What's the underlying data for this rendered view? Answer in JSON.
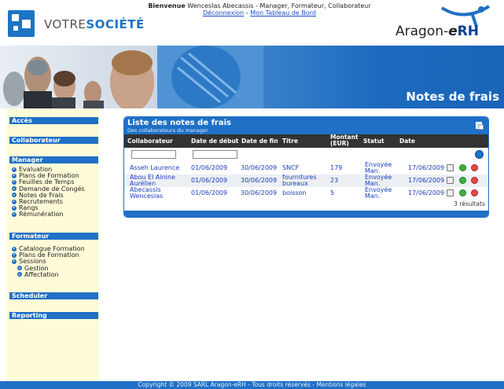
{
  "header": {
    "logo_part1": "VOTRE",
    "logo_part2": "SOCIÉTÉ",
    "welcome_label": "Bienvenue",
    "welcome_user": "Wenceslas Abecassis - Manager, Formateur, Collaborateur",
    "logout_link": "Déconnexion",
    "separator": "-",
    "dashboard_link": "Mon Tableau de Bord",
    "brand_prefix": "Aragon-",
    "brand_e": "e",
    "brand_rh": "RH"
  },
  "banner": {
    "title": "Notes de frais"
  },
  "sidebar": {
    "sections": {
      "acces": "Accès",
      "collaborateur": "Collaborateur",
      "manager": "Manager",
      "formateur": "Formateur",
      "scheduler": "Scheduler",
      "reporting": "Reporting"
    },
    "manager_items": [
      "Evaluation",
      "Plans de Formation",
      "Feuilles de Temps",
      "Demande de Congés",
      "Notes de Frais",
      "Recrutements",
      "Rangs",
      "Rémunération"
    ],
    "formateur_items": [
      "Catalogue Formation",
      "Plans de Formation",
      "Sessions"
    ],
    "sessions_sub": [
      "Gestion",
      "Affectation"
    ]
  },
  "panel": {
    "title": "Liste des notes de frais",
    "subtitle": "Des collaborateurs du manager",
    "columns": {
      "collaborateur": "Collaborateur",
      "date_debut": "Date de début",
      "date_fin": "Date de fin",
      "titre": "Titre",
      "montant_1": "Montant",
      "montant_2": "(EUR)",
      "statut": "Statut",
      "date": "Date"
    },
    "rows": [
      {
        "collab_1": "Asseh Laurence",
        "collab_2": "",
        "debut": "01/06/2009",
        "fin": "30/06/2009",
        "titre_1": "SNCF",
        "titre_2": "",
        "montant": "179",
        "statut_1": "Envoyée",
        "statut_2": "Man.",
        "date": "17/06/2009"
      },
      {
        "collab_1": "Abou El Ainine",
        "collab_2": "Aurélien",
        "debut": "01/06/2009",
        "fin": "30/06/2009",
        "titre_1": "fournitures",
        "titre_2": "bureaux",
        "montant": "23",
        "statut_1": "Envoyée",
        "statut_2": "Man.",
        "date": "17/06/2009"
      },
      {
        "collab_1": "Abecassis",
        "collab_2": "Wenceslas",
        "debut": "01/06/2009",
        "fin": "30/06/2009",
        "titre_1": "boisson",
        "titre_2": "",
        "montant": "5",
        "statut_1": "Envoyée",
        "statut_2": "Man.",
        "date": "17/06/2009"
      }
    ],
    "results": "3 résultats"
  },
  "footer": {
    "text": "Copyright © 2009 SARL Aragon-eRH - Tous droits réservés - Mentions légales"
  },
  "colors": {
    "accent": "#1f70c6",
    "sidebar_bg": "#fefbd8",
    "header_row": "#333333",
    "link": "#1a3fbe"
  }
}
